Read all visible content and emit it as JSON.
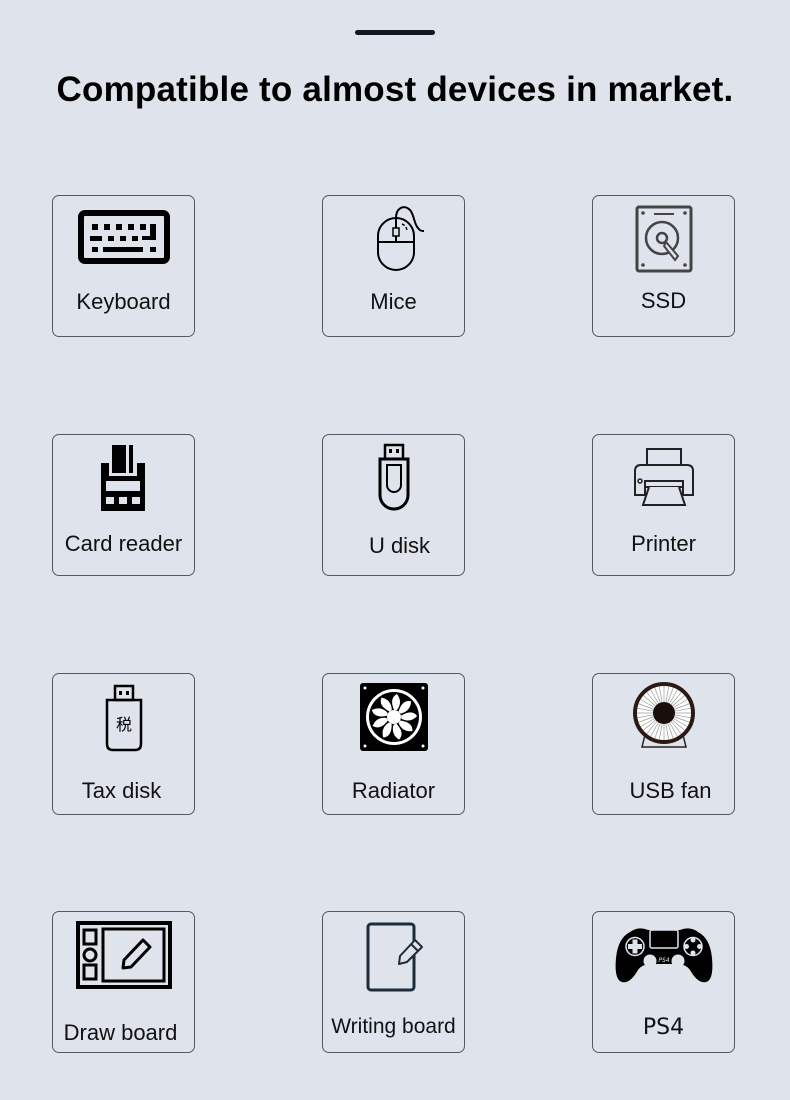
{
  "header": {
    "title": "Compatible to almost devices in market."
  },
  "devices": [
    {
      "label": "Keyboard",
      "icon": "keyboard-icon"
    },
    {
      "label": "Mice",
      "icon": "mouse-icon"
    },
    {
      "label": "SSD",
      "icon": "hard-drive-icon"
    },
    {
      "label": "Card reader",
      "icon": "card-reader-icon"
    },
    {
      "label": "U disk",
      "icon": "usb-drive-icon"
    },
    {
      "label": "Printer",
      "icon": "printer-icon"
    },
    {
      "label": "Tax disk",
      "icon": "tax-usb-key-icon",
      "glyph": "税"
    },
    {
      "label": "Radiator",
      "icon": "cooling-fan-icon"
    },
    {
      "label": "USB fan",
      "icon": "desk-fan-icon"
    },
    {
      "label": "Draw board",
      "icon": "drawing-tablet-icon"
    },
    {
      "label": "Writing board",
      "icon": "writing-tablet-icon"
    },
    {
      "label": "PS4",
      "icon": "gamepad-icon",
      "glyph": "PS4"
    }
  ]
}
